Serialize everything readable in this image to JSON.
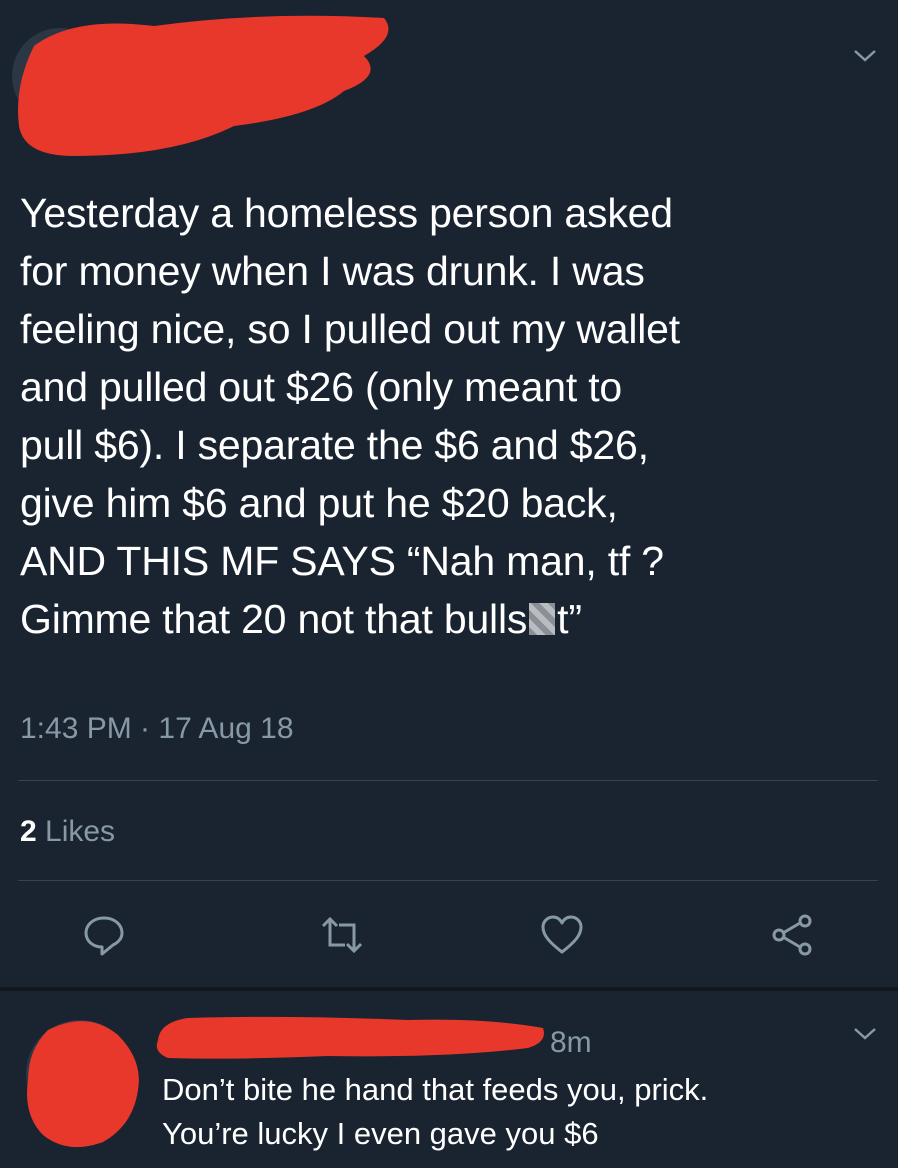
{
  "tweet": {
    "text_before_censor": "Yesterday a homeless person asked\nfor money when I was drunk. I was\nfeeling nice, so I pulled out my wallet\nand pulled out $26 (only meant to\npull $6).  I separate the $6 and $26,\ngive him $6 and put he $20 back,\nAND THIS MF SAYS “Nah man, tf ?\nGimme that 20 not that bulls",
    "text_after_censor": "t”",
    "timestamp": "1:43 PM · 17 Aug 18",
    "likes_count": "2",
    "likes_label": " Likes"
  },
  "reply": {
    "time": "8m",
    "text": "Don’t bite he hand that feeds you, prick.\nYou’re lucky I even gave you $6"
  },
  "colors": {
    "background": "#1a2330",
    "muted": "#8899a6",
    "divider": "#38444d",
    "redaction": "#e8382b"
  },
  "icons": [
    "chevron-down-icon",
    "reply-icon",
    "retweet-icon",
    "like-icon",
    "share-icon"
  ]
}
